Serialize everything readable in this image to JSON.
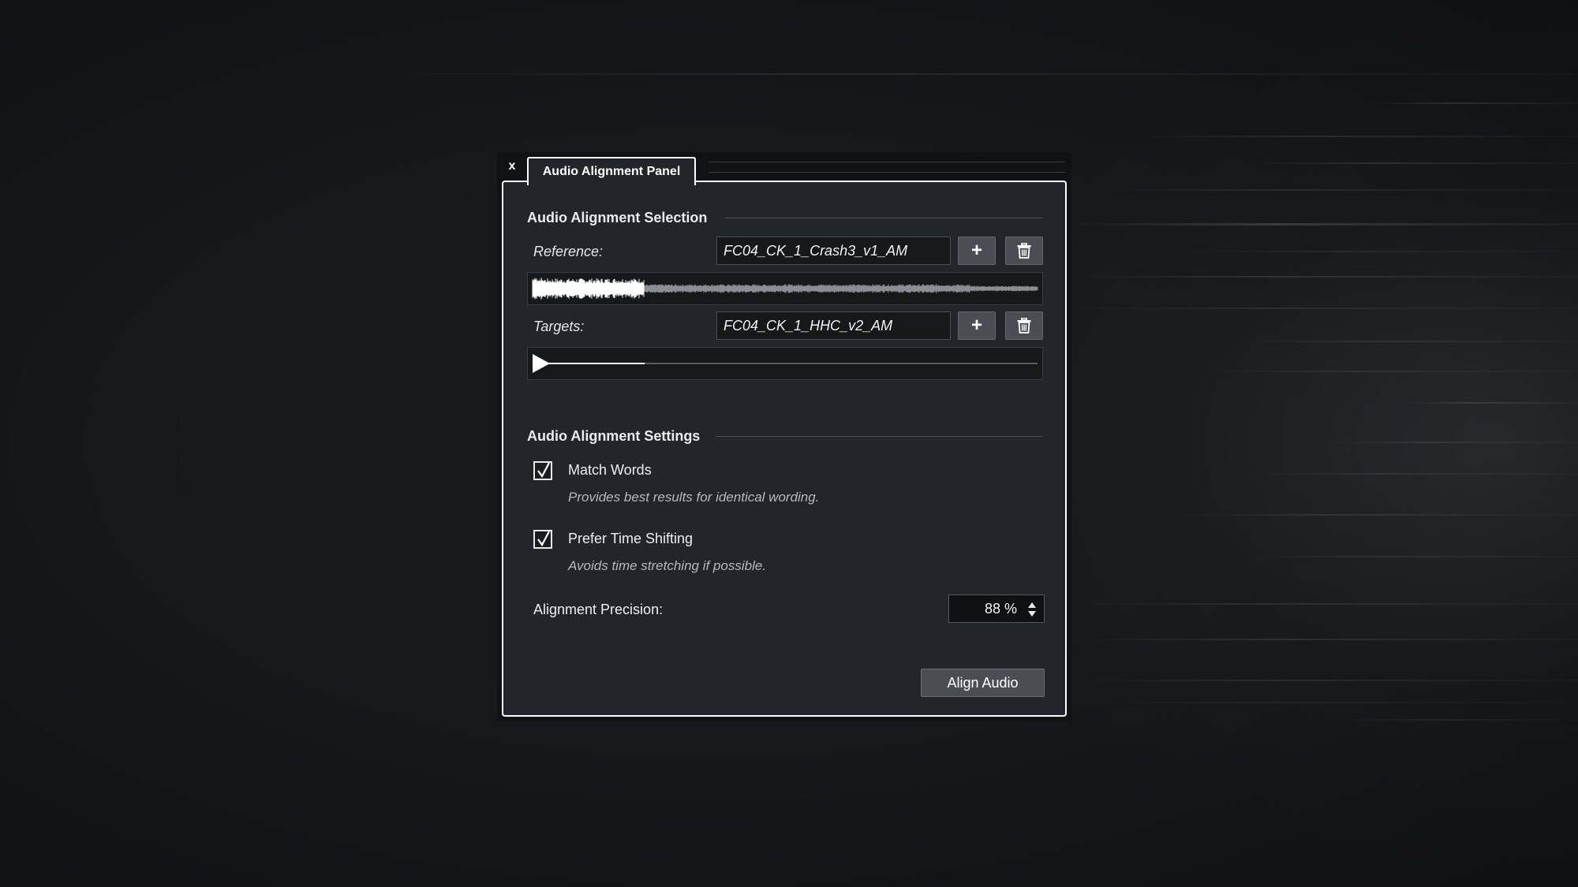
{
  "window": {
    "close_glyph": "x",
    "tab_title": "Audio Alignment Panel"
  },
  "selection": {
    "title": "Audio Alignment Selection",
    "reference": {
      "label": "Reference:",
      "file": "FC04_CK_1_Crash3_v1_AM",
      "add_icon": "plus-icon",
      "delete_icon": "trash-icon"
    },
    "targets": {
      "label": "Targets:",
      "file": "FC04_CK_1_HHC_v2_AM",
      "add_icon": "plus-icon",
      "delete_icon": "trash-icon"
    }
  },
  "settings": {
    "title": "Audio Alignment Settings",
    "match_words": {
      "label": "Match Words",
      "checked": true,
      "description": "Provides best results for identical wording."
    },
    "prefer_time_shifting": {
      "label": "Prefer Time Shifting",
      "checked": true,
      "description": "Avoids time stretching if possible."
    },
    "precision": {
      "label": "Alignment Precision:",
      "value": "88 %"
    }
  },
  "actions": {
    "align_label": "Align Audio"
  },
  "colors": {
    "panel_bg": "#22262a",
    "panel_border": "#ffffff",
    "button_bg": "#4a4e54",
    "field_bg": "#16181a",
    "waveform_highlight": "#ffffff",
    "waveform_dim": "#8a8d91"
  }
}
